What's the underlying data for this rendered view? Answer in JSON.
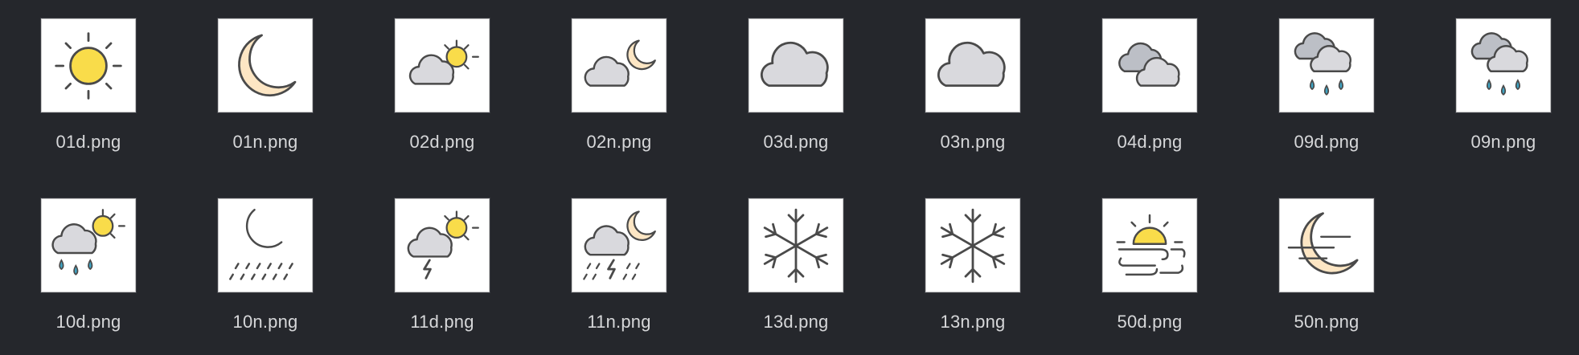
{
  "files": [
    {
      "name": "01d.png",
      "icon": "clear-day-icon"
    },
    {
      "name": "01n.png",
      "icon": "clear-night-icon"
    },
    {
      "name": "02d.png",
      "icon": "few-clouds-day-icon"
    },
    {
      "name": "02n.png",
      "icon": "few-clouds-night-icon"
    },
    {
      "name": "03d.png",
      "icon": "scattered-clouds-icon"
    },
    {
      "name": "03n.png",
      "icon": "scattered-clouds-icon"
    },
    {
      "name": "04d.png",
      "icon": "broken-clouds-icon"
    },
    {
      "name": "09d.png",
      "icon": "shower-rain-icon"
    },
    {
      "name": "09n.png",
      "icon": "shower-rain-icon"
    },
    {
      "name": "10d.png",
      "icon": "rain-day-icon"
    },
    {
      "name": "10n.png",
      "icon": "rain-night-icon"
    },
    {
      "name": "11d.png",
      "icon": "thunderstorm-day-icon"
    },
    {
      "name": "11n.png",
      "icon": "thunderstorm-night-icon"
    },
    {
      "name": "13d.png",
      "icon": "snow-icon"
    },
    {
      "name": "13n.png",
      "icon": "snow-icon"
    },
    {
      "name": "50d.png",
      "icon": "mist-day-icon"
    },
    {
      "name": "50n.png",
      "icon": "mist-night-icon"
    }
  ],
  "colors": {
    "background": "#25272c",
    "thumb_bg": "#ffffff",
    "label": "#d6d7d9",
    "sun": "#f9dc4a",
    "moon": "#fde6c4",
    "cloud": "#d9d9dd",
    "cloud_dark": "#bcbfc6",
    "stroke": "#4a4a4a",
    "drop": "#3fa3c2"
  }
}
